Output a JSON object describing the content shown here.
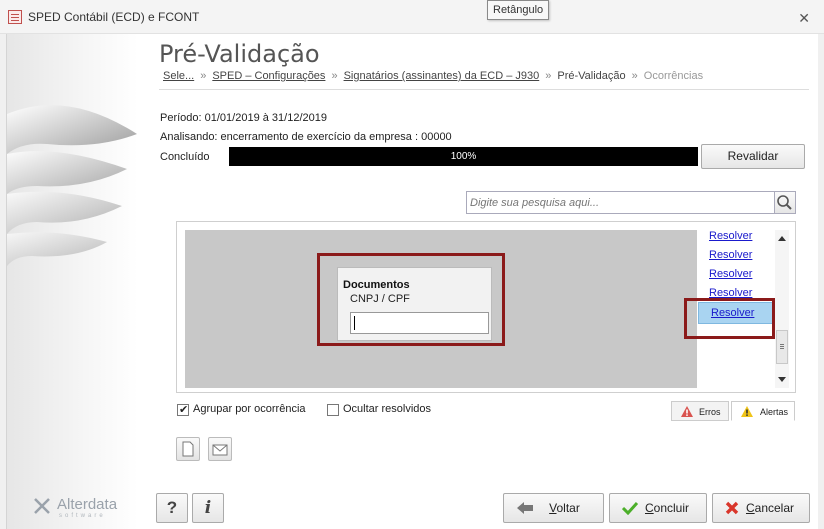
{
  "window": {
    "title": "SPED Contábil (ECD) e FCONT",
    "tooltip": "Retângulo",
    "close_symbol": "✕"
  },
  "brand": {
    "name": "Alterdata",
    "tagline": "software"
  },
  "page": {
    "title": "Pré-Validação",
    "breadcrumb": {
      "items": [
        "Sele...",
        "SPED – Configurações",
        "Signatários (assinantes) da ECD – J930",
        "Pré-Validação",
        "Ocorrências"
      ],
      "separator": "»"
    },
    "period": "Período: 01/01/2019 à 31/12/2019",
    "analyzing": "Analisando: encerramento de exercício da empresa : 00000",
    "progress": {
      "label": "Concluído",
      "value_text": "100%",
      "value": 100
    },
    "revalidate_button": "Revalidar"
  },
  "search": {
    "placeholder": "Digite sua pesquisa aqui..."
  },
  "occurrences": {
    "tip": {
      "title": "Documentos",
      "subtitle": "CNPJ / CPF",
      "value": ""
    },
    "links": [
      "Resolver",
      "Resolver",
      "Resolver",
      "Resolver"
    ],
    "active_link": "Resolver"
  },
  "options": {
    "group_by": {
      "label": "Agrupar por ocorrência",
      "checked": true
    },
    "hide_resolved": {
      "label": "Ocultar resolvidos",
      "checked": false
    }
  },
  "tabs": {
    "errors": "Erros",
    "alerts": "Alertas"
  },
  "footer": {
    "help": "?",
    "info": "i",
    "back": {
      "label_underlined": "V",
      "label_rest": "oltar"
    },
    "finish": {
      "label_underlined": "C",
      "label_rest": "oncluir"
    },
    "cancel": {
      "label_underlined": "C",
      "label_rest": "ancelar"
    }
  },
  "colors": {
    "highlight_border": "#8b1a1a",
    "link": "#1a1acc",
    "active_row": "#a9d4f1",
    "progress_bar": "#000000"
  }
}
